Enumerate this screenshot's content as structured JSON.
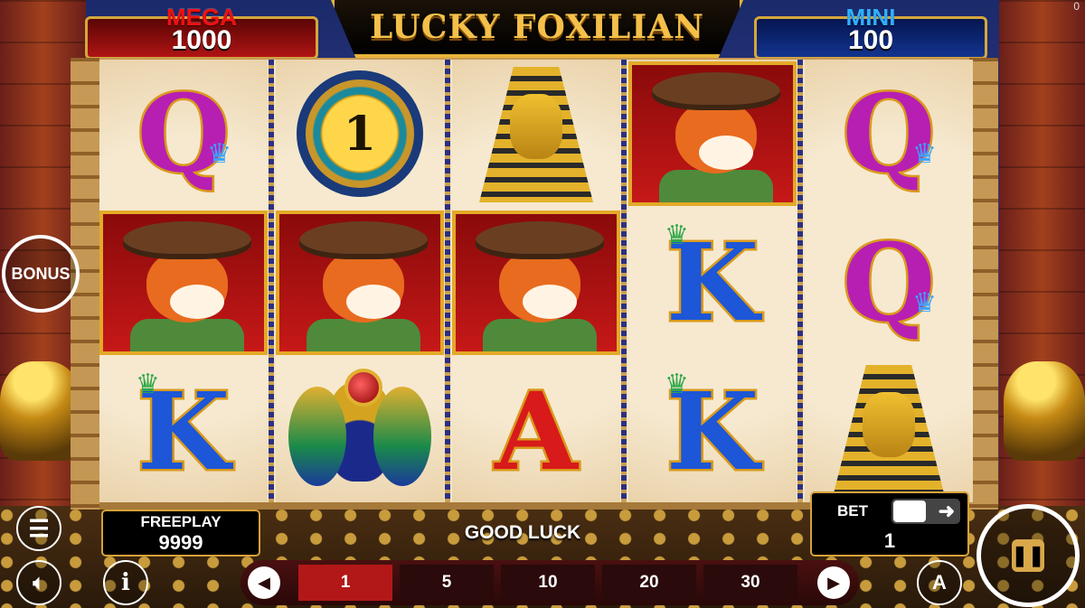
{
  "jackpots": {
    "mega": {
      "label": "MEGA",
      "value": "1000"
    },
    "mini": {
      "label": "MINI",
      "value": "100"
    }
  },
  "game_title": "LUCKY FOXILIAN",
  "reels": [
    [
      {
        "symbol": "Q",
        "kind": "letter"
      },
      {
        "symbol": "fox",
        "kind": "picture"
      },
      {
        "symbol": "K",
        "kind": "letter"
      }
    ],
    [
      {
        "symbol": "1",
        "kind": "coin"
      },
      {
        "symbol": "fox",
        "kind": "picture"
      },
      {
        "symbol": "scarab",
        "kind": "picture"
      }
    ],
    [
      {
        "symbol": "pharaoh",
        "kind": "picture"
      },
      {
        "symbol": "fox",
        "kind": "picture"
      },
      {
        "symbol": "A",
        "kind": "letter"
      }
    ],
    [
      {
        "symbol": "fox",
        "kind": "picture"
      },
      {
        "symbol": "K",
        "kind": "letter"
      },
      {
        "symbol": "K",
        "kind": "letter"
      }
    ],
    [
      {
        "symbol": "Q",
        "kind": "letter"
      },
      {
        "symbol": "Q",
        "kind": "letter"
      },
      {
        "symbol": "pharaoh",
        "kind": "picture"
      }
    ]
  ],
  "bonus_button": {
    "label": "BONUS"
  },
  "freeplay": {
    "label": "FREEPLAY",
    "value": "9999"
  },
  "message": "GOOD LUCK",
  "bet": {
    "label": "BET",
    "value": "1"
  },
  "bet_options": [
    "1",
    "5",
    "10",
    "20",
    "30"
  ],
  "bet_selected": "1",
  "autoplay_label": "A",
  "info_label": "i",
  "corner_text": "0",
  "icons": {
    "menu": "hamburger-menu-icon",
    "sound": "speaker-icon",
    "info": "info-icon",
    "prev": "chevron-left-icon",
    "next": "chevron-right-icon",
    "spin": "spin-pause-icon"
  },
  "colors": {
    "accent_gold": "#d6a23a",
    "selected_bet": "#b31818",
    "mega": "#e11111",
    "mini": "#2fb0ff"
  }
}
